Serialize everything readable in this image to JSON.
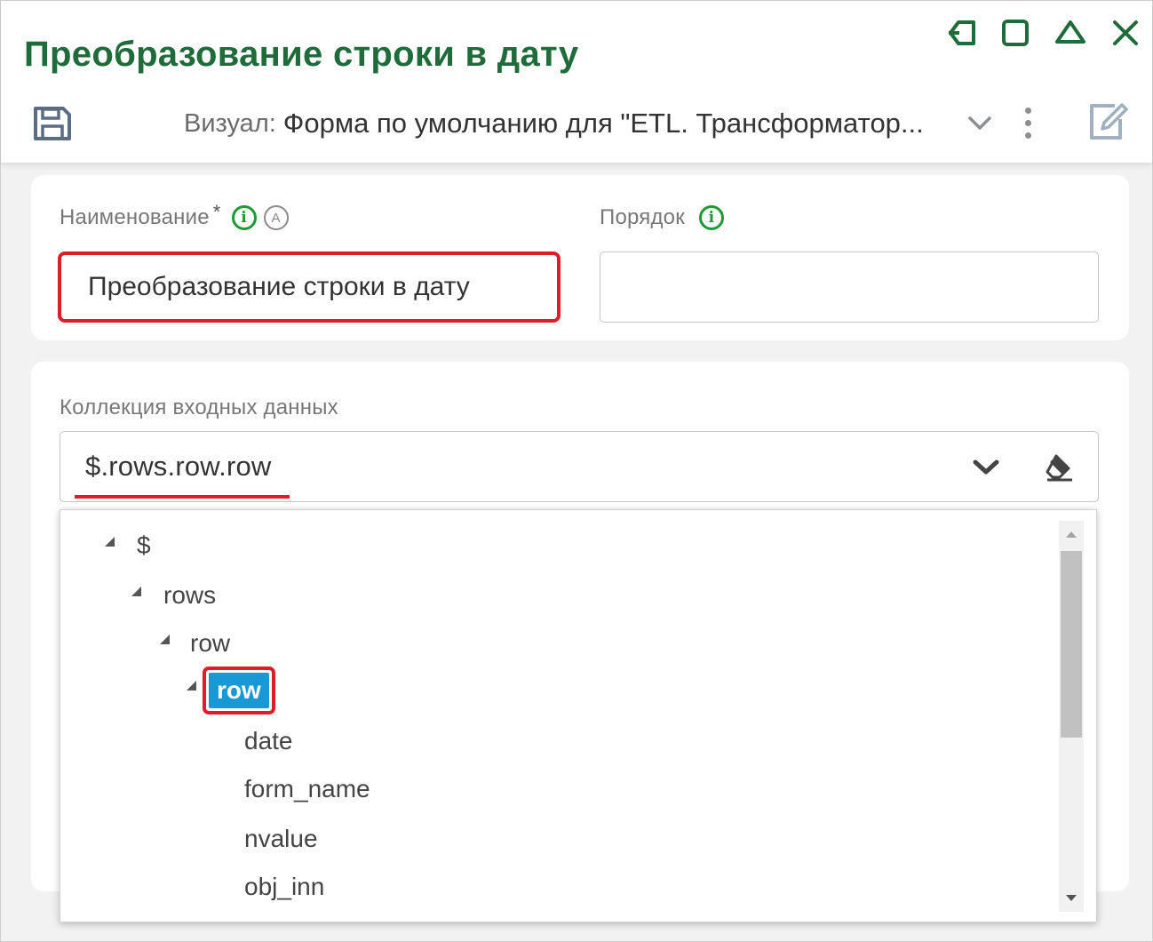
{
  "header": {
    "title": "Преобразование строки в дату",
    "visual_label": "Визуал:",
    "visual_value": "Форма по умолчанию для \"ETL. Трансформатор...",
    "icons": [
      "pin-icon",
      "maximize-icon",
      "collapse-icon",
      "close-icon",
      "save-icon",
      "chevron-down-icon",
      "more-vertical-icon",
      "edit-icon"
    ]
  },
  "form": {
    "name_label": "Наименование",
    "required_mark": "*",
    "name_value": "Преобразование строки в дату",
    "order_label": "Порядок",
    "order_value": "",
    "collection_label": "Коллекция входных данных",
    "collection_value": "$.rows.row.row"
  },
  "tree": {
    "nodes": [
      {
        "label": "$",
        "expanded": true
      },
      {
        "label": "rows",
        "expanded": true
      },
      {
        "label": "row",
        "expanded": true
      },
      {
        "label": "row",
        "expanded": true,
        "selected": true
      },
      {
        "label": "date"
      },
      {
        "label": "form_name"
      },
      {
        "label": "nvalue"
      },
      {
        "label": "obj_inn"
      }
    ]
  },
  "colors": {
    "title_green": "#1f6b3a",
    "info_green": "#1e9a34",
    "highlight_red": "#e11c2a",
    "selection_blue": "#1899d6",
    "icon_gray": "#8a8f94"
  }
}
